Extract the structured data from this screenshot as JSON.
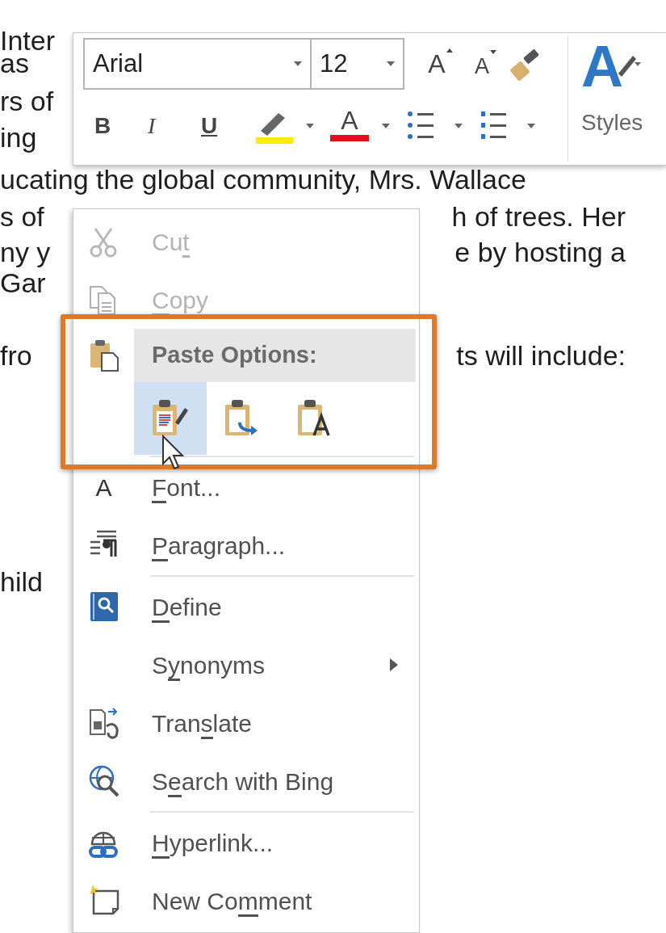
{
  "document_lines": [
    {
      "left": "Inter"
    },
    {
      "left": "as"
    },
    {
      "left": "rs of"
    },
    {
      "left": "ing"
    },
    {
      "left": "ucating the global community, Mrs. Wallace"
    },
    {
      "left": "s of",
      "right": "h of trees. Her"
    },
    {
      "left": "ny y",
      "right": "e by hosting a"
    },
    {
      "left": "Gar"
    },
    {
      "left": "fro",
      "right": "ts will include:"
    },
    {
      "left": "hild"
    }
  ],
  "mini_toolbar": {
    "font_name": "Arial",
    "font_size": "12",
    "grow_glyph": "A",
    "shrink_glyph": "A",
    "format_buttons": [
      {
        "kind": "bold",
        "glyph": "B"
      },
      {
        "kind": "italic",
        "glyph": "I"
      },
      {
        "kind": "underline",
        "glyph": "U"
      }
    ],
    "font_color_glyph": "A",
    "styles_glyph": "A",
    "styles_label": "Styles"
  },
  "context_menu": {
    "items": [
      {
        "kind": "cut",
        "disabled": true,
        "label": [
          {
            "text": "Cu",
            "underlined": false
          },
          {
            "text": "t",
            "underlined": true
          }
        ]
      },
      {
        "kind": "copy",
        "disabled": true,
        "label": [
          {
            "text": "C",
            "underlined": true
          },
          {
            "text": "opy",
            "underlined": false
          }
        ]
      },
      {
        "kind": "paste_options",
        "header": "Paste Options:",
        "highlight": true,
        "options": [
          {
            "kind": "keep",
            "selected": true
          },
          {
            "kind": "merge",
            "selected": false
          },
          {
            "kind": "text",
            "selected": false
          }
        ]
      },
      {
        "kind": "separator"
      },
      {
        "kind": "font",
        "icon_glyph": "A",
        "disabled": false,
        "label": [
          {
            "text": "F",
            "underlined": true
          },
          {
            "text": "ont...",
            "underlined": false
          }
        ]
      },
      {
        "kind": "paragraph",
        "disabled": false,
        "label": [
          {
            "text": "P",
            "underlined": true
          },
          {
            "text": "aragraph...",
            "underlined": false
          }
        ]
      },
      {
        "kind": "separator"
      },
      {
        "kind": "define",
        "disabled": false,
        "label": [
          {
            "text": "D",
            "underlined": true
          },
          {
            "text": "efine",
            "underlined": false
          }
        ]
      },
      {
        "kind": "synonyms",
        "disabled": false,
        "label": [
          {
            "text": "S",
            "underlined": false
          },
          {
            "text": "y",
            "underlined": true
          },
          {
            "text": "nonyms",
            "underlined": false
          }
        ]
      },
      {
        "kind": "translate",
        "disabled": false,
        "label": [
          {
            "text": "Tran",
            "underlined": false
          },
          {
            "text": "s",
            "underlined": true
          },
          {
            "text": "late",
            "underlined": false
          }
        ]
      },
      {
        "kind": "search",
        "disabled": false,
        "label": [
          {
            "text": "S",
            "underlined": false
          },
          {
            "text": "e",
            "underlined": true
          },
          {
            "text": "arch with Bing",
            "underlined": false
          }
        ]
      },
      {
        "kind": "separator"
      },
      {
        "kind": "hyperlink",
        "disabled": false,
        "label": [
          {
            "text": "H",
            "underlined": true
          },
          {
            "text": "yperlink...",
            "underlined": false
          }
        ]
      },
      {
        "kind": "comment",
        "disabled": false,
        "label": [
          {
            "text": "New Co",
            "underlined": false
          },
          {
            "text": "m",
            "underlined": true
          },
          {
            "text": "ment",
            "underlined": false
          }
        ]
      }
    ]
  }
}
